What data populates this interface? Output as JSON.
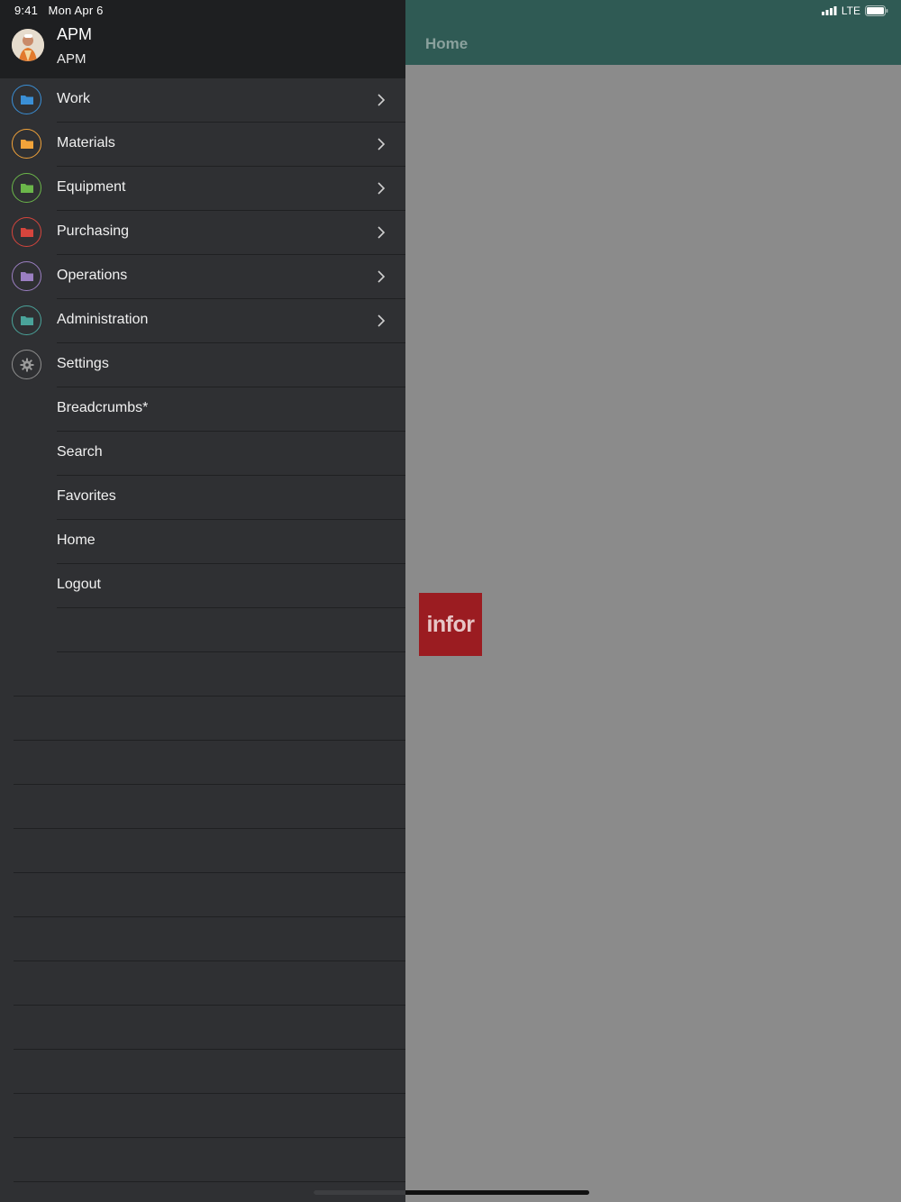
{
  "status_bar": {
    "time": "9:41",
    "date": "Mon Apr 6",
    "network": "LTE"
  },
  "user": {
    "name": "APM",
    "role": "APM"
  },
  "menu": [
    {
      "label": "Work",
      "icon": "folder-icon",
      "color": "#3a8fd6",
      "chevron": true
    },
    {
      "label": "Materials",
      "icon": "folder-icon",
      "color": "#f2a33a",
      "chevron": true
    },
    {
      "label": "Equipment",
      "icon": "folder-icon",
      "color": "#6bb64a",
      "chevron": true
    },
    {
      "label": "Purchasing",
      "icon": "folder-icon",
      "color": "#d6453d",
      "chevron": true
    },
    {
      "label": "Operations",
      "icon": "folder-icon",
      "color": "#9b7fc2",
      "chevron": true
    },
    {
      "label": "Administration",
      "icon": "folder-icon",
      "color": "#4aa39a",
      "chevron": true
    },
    {
      "label": "Settings",
      "icon": "gear-icon",
      "color": "#9a9a9a",
      "chevron": false
    },
    {
      "label": "Breadcrumbs*"
    },
    {
      "label": "Search"
    },
    {
      "label": "Favorites"
    },
    {
      "label": "Home"
    },
    {
      "label": "Logout"
    }
  ],
  "appbar": {
    "title": "Home"
  },
  "logo": {
    "text": "infor",
    "color": "#9b1c21"
  }
}
